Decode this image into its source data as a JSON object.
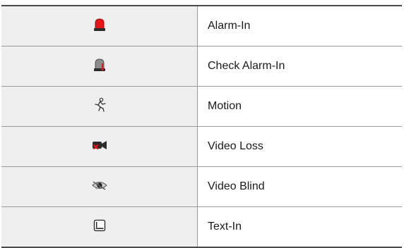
{
  "rows": [
    {
      "icon": "alarm-in-icon",
      "label": "Alarm-In"
    },
    {
      "icon": "check-alarm-in-icon",
      "label": "Check Alarm-In"
    },
    {
      "icon": "motion-icon",
      "label": "Motion"
    },
    {
      "icon": "video-loss-icon",
      "label": "Video Loss"
    },
    {
      "icon": "video-blind-icon",
      "label": "Video Blind"
    },
    {
      "icon": "text-in-icon",
      "label": "Text-In"
    }
  ],
  "colors": {
    "icon_cell_bg": "#efefef",
    "alarm_red": "#e8141c",
    "border": "#9a9a9a"
  }
}
